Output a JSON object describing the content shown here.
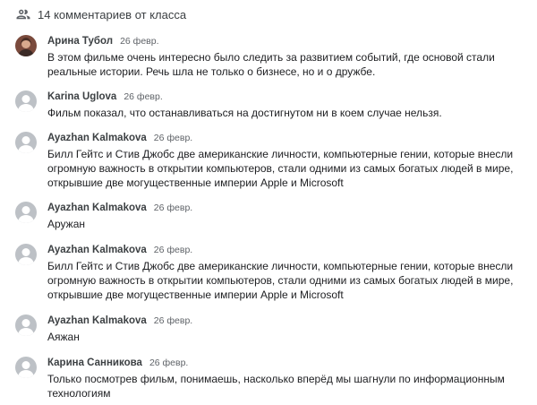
{
  "header": {
    "icon": "people-icon",
    "title": "14 комментариев от класса"
  },
  "comments": [
    {
      "author": "Арина Тубол",
      "date": "26 февр.",
      "avatar": "photo",
      "text": "В этом фильме очень интересно было следить за развитием событий, где основой стали реальные истории. Речь шла не только о бизнесе, но и о дружбе."
    },
    {
      "author": "Karina Uglova",
      "date": "26 февр.",
      "avatar": "default",
      "text": "Фильм показал, что останавливаться на достигнутом ни в коем случае нельзя."
    },
    {
      "author": "Ayazhan Kalmakova",
      "date": "26 февр.",
      "avatar": "default",
      "text": "Билл Гейтс и Стив Джобс две американские личности, компьютерные гении,  которые внесли огромную важность в открытии компьютеров, стали одними из самых богатых людей в мире, открывшие две могущественные империи Apple и  Microsoft"
    },
    {
      "author": "Ayazhan Kalmakova",
      "date": "26 февр.",
      "avatar": "default",
      "text": "Аружан"
    },
    {
      "author": "Ayazhan Kalmakova",
      "date": "26 февр.",
      "avatar": "default",
      "text": "Билл Гейтс и Стив Джобс две американские личности, компьютерные гении,  которые внесли огромную важность в открытии компьютеров, стали одними из самых богатых людей в мире, открывшие две могущественные империи Apple и  Microsoft"
    },
    {
      "author": "Ayazhan Kalmakova",
      "date": "26 февр.",
      "avatar": "default",
      "text": "Аяжан"
    },
    {
      "author": "Карина Санникова",
      "date": "26 февр.",
      "avatar": "default",
      "text": "Только посмотрев фильм, понимаешь, насколько вперёд мы шагнули по информационным технологиям"
    }
  ]
}
